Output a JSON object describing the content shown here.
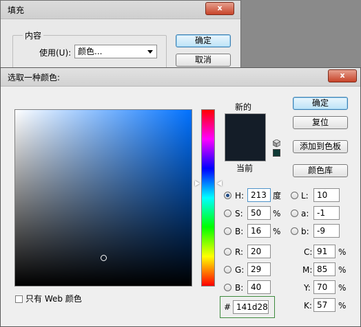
{
  "fill_dialog": {
    "title": "填充",
    "close_label": "x",
    "content_group_label": "内容",
    "use_label": "使用(U):",
    "use_value": "颜色...",
    "ok_label": "确定",
    "cancel_label": "取消"
  },
  "picker_dialog": {
    "title": "选取一种颜色:",
    "close_label": "x",
    "new_label": "新的",
    "current_label": "当前",
    "new_color": "#141d28",
    "current_color": "#141d28",
    "web_color_swatch": "#0f3a35",
    "buttons": {
      "ok": "确定",
      "reset": "复位",
      "add_to_swatches": "添加到色板",
      "color_libraries": "颜色库"
    },
    "web_only_label": "只有 Web 颜色",
    "hsb": [
      {
        "key": "H:",
        "value": "213",
        "unit": "度",
        "selected": true
      },
      {
        "key": "S:",
        "value": "50",
        "unit": "%",
        "selected": false
      },
      {
        "key": "B:",
        "value": "16",
        "unit": "%",
        "selected": false
      }
    ],
    "rgb": [
      {
        "key": "R:",
        "value": "20",
        "selected": false
      },
      {
        "key": "G:",
        "value": "29",
        "selected": false
      },
      {
        "key": "B:",
        "value": "40",
        "selected": false
      }
    ],
    "lab": [
      {
        "key": "L:",
        "value": "10",
        "selected": false
      },
      {
        "key": "a:",
        "value": "-1",
        "selected": false
      },
      {
        "key": "b:",
        "value": "-9",
        "selected": false
      }
    ],
    "cmyk": [
      {
        "key": "C:",
        "value": "91",
        "unit": "%"
      },
      {
        "key": "M:",
        "value": "85",
        "unit": "%"
      },
      {
        "key": "Y:",
        "value": "70",
        "unit": "%"
      },
      {
        "key": "K:",
        "value": "57",
        "unit": "%"
      }
    ],
    "hex_label": "#",
    "hex_value": "141d28"
  }
}
